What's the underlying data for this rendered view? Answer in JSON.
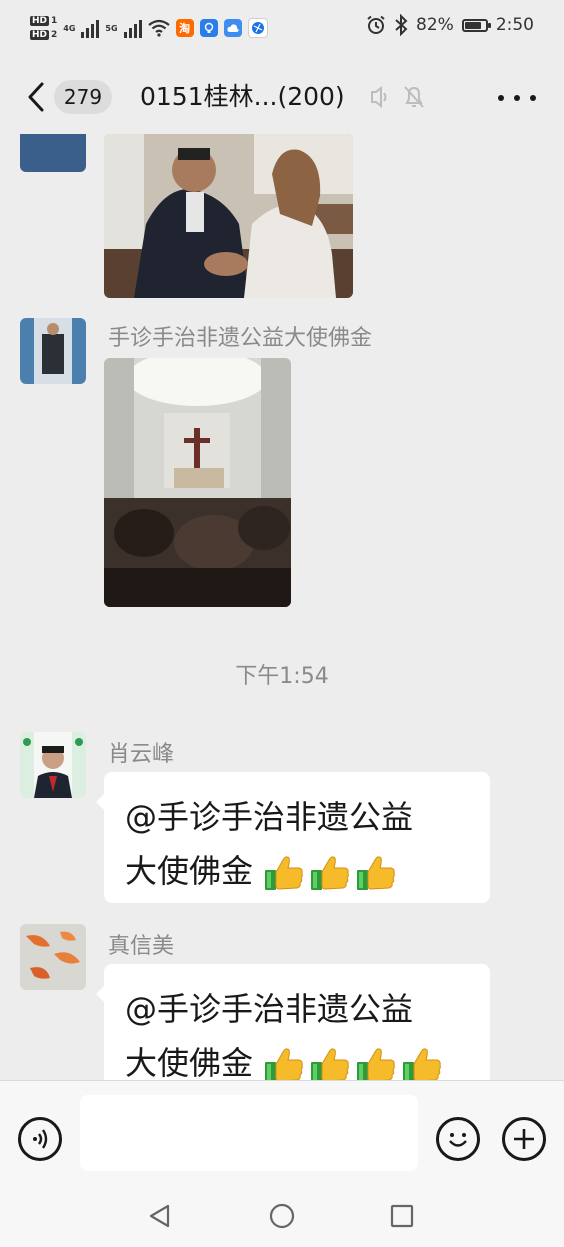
{
  "status_bar": {
    "hd1": "HD",
    "hd1_sub": "1",
    "hd2": "HD",
    "hd2_sub": "2",
    "net1": "4G",
    "net2": "5G",
    "battery_percent": "82%",
    "battery_level": 0.82,
    "time": "2:50",
    "icons": [
      "wifi-icon",
      "taobao-icon",
      "lightbulb-app-icon",
      "cloud-app-icon",
      "browser-app-icon",
      "alarm-icon",
      "bluetooth-icon",
      "battery-icon"
    ],
    "taobao_glyph": "淘"
  },
  "header": {
    "unread_count": "279",
    "title": "0151桂林...(200)",
    "icons": [
      "back-chevron-icon",
      "earpiece-icon",
      "mute-bell-icon",
      "more-dots-icon"
    ]
  },
  "messages": [
    {
      "type": "image",
      "sender": "",
      "description": "partial-photo-top"
    },
    {
      "type": "image",
      "sender": "手诊手治非遗公益大使佛金"
    },
    {
      "type": "timestamp",
      "text": "下午1:54"
    },
    {
      "type": "text",
      "sender": "肖云峰",
      "line1": "@手诊手治非遗公益",
      "line2": "大使佛金",
      "emoji_count": 3
    },
    {
      "type": "text",
      "sender": "真信美",
      "line1": "@手诊手治非遗公益",
      "line2": "大使佛金",
      "emoji_count": 4
    }
  ],
  "input_bar": {
    "value": "",
    "icons": [
      "voice-icon",
      "emoji-icon",
      "plus-icon"
    ]
  },
  "nav_bar": {
    "icons": [
      "back-triangle-icon",
      "home-circle-icon",
      "recents-square-icon"
    ]
  },
  "colors": {
    "background": "#ededed",
    "bubble": "#ffffff",
    "text": "#191919",
    "muted": "#8a8a8a"
  }
}
